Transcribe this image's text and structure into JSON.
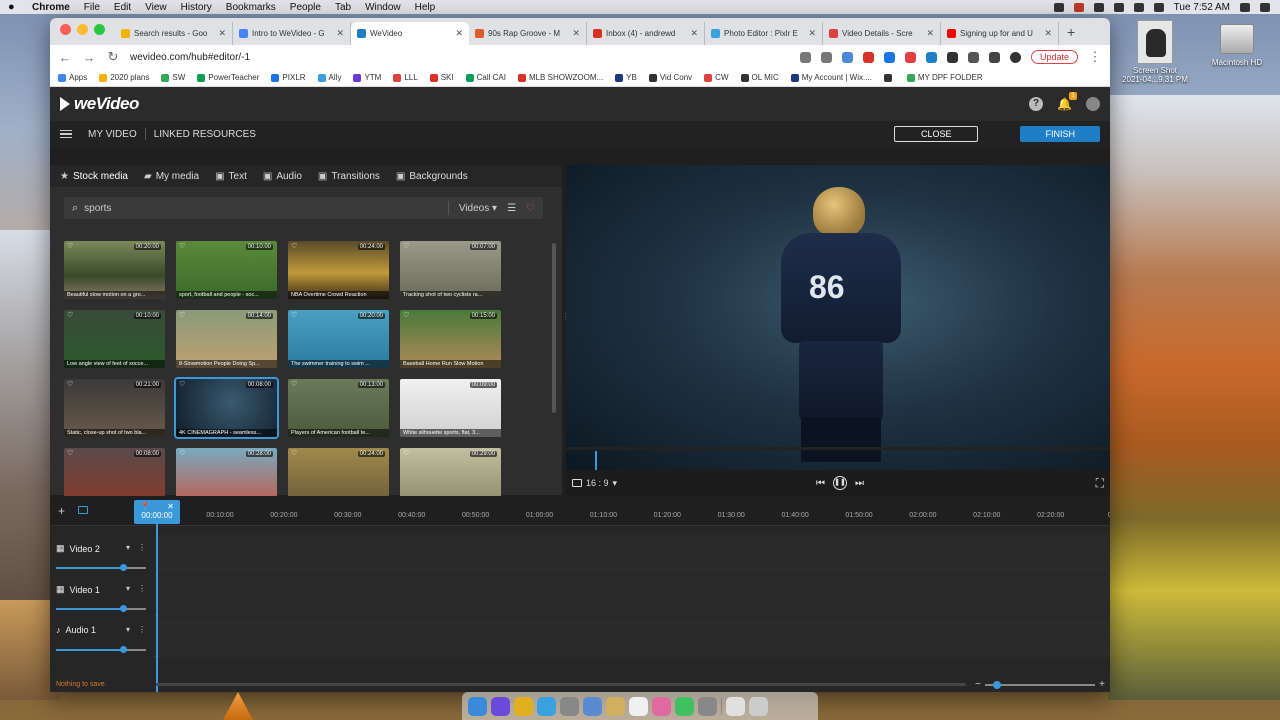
{
  "menubar": {
    "apple": "",
    "app": "Chrome",
    "items": [
      "File",
      "Edit",
      "View",
      "History",
      "Bookmarks",
      "People",
      "Tab",
      "Window",
      "Help"
    ],
    "clock": "Tue 7:52 AM"
  },
  "desktop": {
    "screenshot_label_1": "Screen Shot",
    "screenshot_label_2": "2021-04...9.31 PM",
    "hd_label": "Macintosh HD"
  },
  "browser": {
    "tabs": [
      {
        "title": "Search results - Goo",
        "color": "#f4b400"
      },
      {
        "title": "Intro to WeVideo - G",
        "color": "#4285f4"
      },
      {
        "title": "WeVideo",
        "color": "#1e7fc6",
        "active": true
      },
      {
        "title": "90s Rap Groove - M",
        "color": "#e05a2a"
      },
      {
        "title": "Inbox (4) - andrewd",
        "color": "#d93025"
      },
      {
        "title": "Photo Editor : Pixlr E",
        "color": "#3aa0e0"
      },
      {
        "title": "Video Details - Scre",
        "color": "#e04040"
      },
      {
        "title": "Signing up for and U",
        "color": "#ff0000"
      }
    ],
    "url": "wevideo.com/hub#editor/-1",
    "update_label": "Update",
    "bookmarks": [
      "Apps",
      "2020 plans",
      "SW",
      "PowerTeacher",
      "PIXLR",
      "Ally",
      "YTM",
      "LLL",
      "SKI",
      "Call CAI",
      "MLB SHOWZOOM...",
      "YB",
      "Vid Conv",
      "CW",
      "OL MIC",
      "My Account | Wix....",
      "",
      "MY DPF FOLDER"
    ]
  },
  "wevideo": {
    "logo": "weVideo",
    "help_icon": "?",
    "notification_count": "1",
    "subnav": {
      "my_video": "MY VIDEO",
      "linked_resources": "LINKED RESOURCES",
      "close": "CLOSE",
      "finish": "FINISH"
    },
    "media_tabs": [
      "Stock media",
      "My media",
      "Text",
      "Audio",
      "Transitions",
      "Backgrounds"
    ],
    "search": {
      "value": "sports",
      "filter": "Videos"
    },
    "thumbnails": [
      {
        "dur": "00:20:00",
        "cap": "Beautiful slow motion on a gro...",
        "bg": "linear-gradient(180deg,#7a8a5a,#3a4a2a 60%,#8a7a6a)"
      },
      {
        "dur": "00:10:00",
        "cap": "sport, football and people - soc...",
        "bg": "linear-gradient(180deg,#5a8a3a,#3a6a2a)"
      },
      {
        "dur": "00:24:00",
        "cap": "NBA Overtime Crowd Reaction",
        "bg": "linear-gradient(180deg,#5a4a2a,#c09a3a 55%,#3a2a1a)"
      },
      {
        "dur": "00:07:00",
        "cap": "Tracking shot of two cyclists ra...",
        "bg": "linear-gradient(180deg,#9a9a8a,#6a6a5a)"
      },
      {
        "dur": "00:10:00",
        "cap": "Low angle view of feet of socce...",
        "bg": "linear-gradient(180deg,#3a4a3a,#2a5a2a)"
      },
      {
        "dur": "00:14:00",
        "cap": "8-Slowmotion People Doing Sp...",
        "bg": "linear-gradient(180deg,#8a9a7a,#c0a070)"
      },
      {
        "dur": "00:20:00",
        "cap": "The swimmer training to swim ...",
        "bg": "linear-gradient(180deg,#4aa0c0,#2a7aa0)"
      },
      {
        "dur": "00:15:00",
        "cap": "Baseball Home Run Slow Motion",
        "bg": "linear-gradient(180deg,#4a7a3a,#b08a5a)"
      },
      {
        "dur": "00:21:00",
        "cap": "Static, close-up shot of two bla...",
        "bg": "linear-gradient(180deg,#3a3a3a,#6a5a4a)"
      },
      {
        "dur": "00:08:00",
        "cap": "4K CINEMAGRAPH - seamless...",
        "bg": "radial-gradient(circle at 55% 40%,#3a5a70,#0f1c28)",
        "selected": true
      },
      {
        "dur": "00:13:00",
        "cap": "Players of American football te...",
        "bg": "linear-gradient(180deg,#6a7a5a,#4a5a3a)"
      },
      {
        "dur": "00:09:00",
        "cap": "White silhouette sports, flat, 3...",
        "bg": "linear-gradient(180deg,#f0f0f0,#d0d0d0)"
      },
      {
        "dur": "00:08:00",
        "cap": "",
        "bg": "linear-gradient(180deg,#5a4a4a,#8a3a2a)"
      },
      {
        "dur": "00:28:00",
        "cap": "",
        "bg": "linear-gradient(180deg,#7aaac0,#c05a4a)"
      },
      {
        "dur": "00:24:00",
        "cap": "",
        "bg": "linear-gradient(180deg,#a08a4a,#6a5a3a)"
      },
      {
        "dur": "00:29:00",
        "cap": "",
        "bg": "linear-gradient(180deg,#c0c0a0,#8a8a6a)"
      }
    ],
    "preview": {
      "jersey_number": "86",
      "aspect_ratio": "16 : 9"
    },
    "timeline": {
      "playhead_time": "00:00:00",
      "ticks": [
        "00:10:00",
        "00:20:00",
        "00:30:00",
        "00:40:00",
        "00:50:00",
        "01:00:00",
        "01:10:00",
        "01:20:00",
        "01:30:00",
        "01:40:00",
        "01:50:00",
        "02:00:00",
        "02:10:00",
        "02:20:00",
        "02:3"
      ],
      "tracks": [
        {
          "name": "Video 2",
          "type": "video"
        },
        {
          "name": "Video 1",
          "type": "video"
        },
        {
          "name": "Audio 1",
          "type": "audio"
        }
      ],
      "status": "Nothing to save."
    }
  },
  "dock": {
    "icons": [
      "finder-icon",
      "siri-icon",
      "chrome-icon",
      "safari-icon",
      "launchpad-icon",
      "preview-icon",
      "notes-icon",
      "calendar-icon",
      "photos-icon",
      "messages-icon",
      "settings-icon",
      "sep",
      "folder-icon",
      "trash-icon"
    ],
    "colors": [
      "#3a8ad9",
      "#6a4ad9",
      "#e0b020",
      "#3aa0e0",
      "#888",
      "#5a8ad0",
      "#d0b060",
      "#f0f0f0",
      "#e06aa0",
      "#40c060",
      "#888",
      "",
      "#e0e0e0",
      "#ccc"
    ]
  }
}
